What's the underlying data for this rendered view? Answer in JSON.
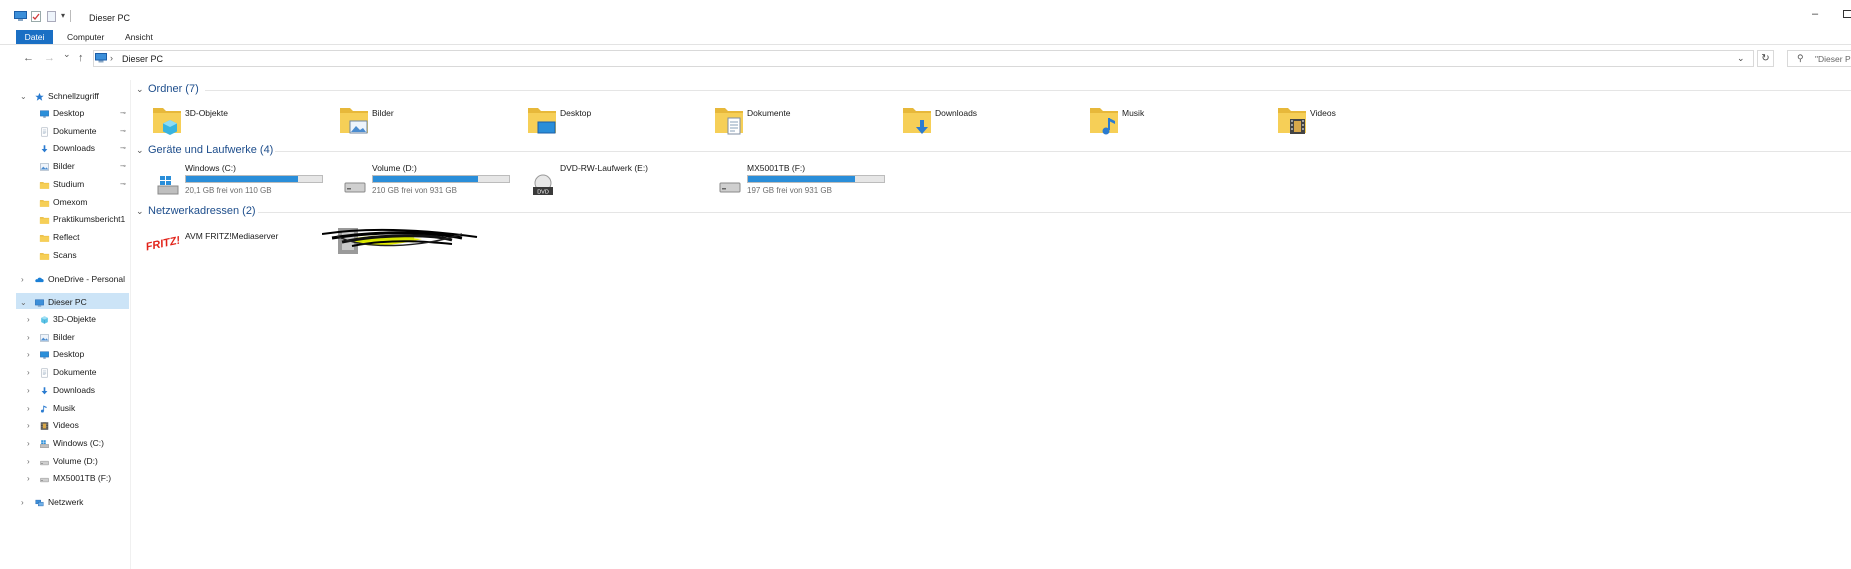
{
  "window": {
    "title": "Dieser PC",
    "minimize_glyph": "–"
  },
  "ribbon": {
    "tabs": [
      "Datei",
      "Computer",
      "Ansicht"
    ]
  },
  "address": {
    "path": "Dieser PC",
    "separator": "›",
    "search_placeholder": "\"Dieser P"
  },
  "icons": {
    "back": "←",
    "forward": "→",
    "recent": "⌄",
    "up": "↑",
    "dropdown": "⌄",
    "refresh": "↻",
    "search": "⚲",
    "chevron_down": "⌄",
    "chevron_right": "›",
    "pin": "📌"
  },
  "nav": {
    "quick_access": {
      "label": "Schnellzugriff",
      "items": [
        {
          "label": "Desktop",
          "icon": "desktop-icon",
          "pinned": true
        },
        {
          "label": "Dokumente",
          "icon": "documents-icon",
          "pinned": true
        },
        {
          "label": "Downloads",
          "icon": "downloads-icon",
          "pinned": true
        },
        {
          "label": "Bilder",
          "icon": "pictures-icon",
          "pinned": true
        },
        {
          "label": "Studium",
          "icon": "folder-icon",
          "pinned": true
        },
        {
          "label": "Omexom",
          "icon": "folder-icon",
          "pinned": false
        },
        {
          "label": "Praktikumsbericht1",
          "icon": "folder-icon",
          "pinned": false
        },
        {
          "label": "Reflect",
          "icon": "folder-icon",
          "pinned": false
        },
        {
          "label": "Scans",
          "icon": "folder-icon",
          "pinned": false
        }
      ]
    },
    "onedrive": {
      "label": "OneDrive - Personal"
    },
    "this_pc": {
      "label": "Dieser PC",
      "items": [
        {
          "label": "3D-Objekte",
          "icon": "3d-objects-icon"
        },
        {
          "label": "Bilder",
          "icon": "pictures-icon"
        },
        {
          "label": "Desktop",
          "icon": "desktop-icon"
        },
        {
          "label": "Dokumente",
          "icon": "documents-icon"
        },
        {
          "label": "Downloads",
          "icon": "downloads-icon"
        },
        {
          "label": "Musik",
          "icon": "music-icon"
        },
        {
          "label": "Videos",
          "icon": "videos-icon"
        },
        {
          "label": "Windows (C:)",
          "icon": "windows-drive-icon"
        },
        {
          "label": "Volume (D:)",
          "icon": "drive-icon"
        },
        {
          "label": "MX5001TB (F:)",
          "icon": "drive-icon"
        }
      ]
    },
    "network": {
      "label": "Netzwerk"
    }
  },
  "content": {
    "folders_header": "Ordner (7)",
    "folders": [
      {
        "label": "3D-Objekte",
        "icon": "3d-objects-icon"
      },
      {
        "label": "Bilder",
        "icon": "pictures-icon"
      },
      {
        "label": "Desktop",
        "icon": "desktop-icon"
      },
      {
        "label": "Dokumente",
        "icon": "documents-icon"
      },
      {
        "label": "Downloads",
        "icon": "downloads-icon"
      },
      {
        "label": "Musik",
        "icon": "music-icon"
      },
      {
        "label": "Videos",
        "icon": "videos-icon"
      }
    ],
    "drives_header": "Geräte und Laufwerke (4)",
    "drives": [
      {
        "label": "Windows (C:)",
        "free_text": "20,1 GB frei von 110 GB",
        "used_fraction": 0.82,
        "icon": "windows-drive-icon",
        "has_bar": true
      },
      {
        "label": "Volume (D:)",
        "free_text": "210 GB frei von 931 GB",
        "used_fraction": 0.77,
        "icon": "drive-icon",
        "has_bar": true
      },
      {
        "label": "DVD-RW-Laufwerk (E:)",
        "free_text": "",
        "used_fraction": 0,
        "icon": "dvd-drive-icon",
        "has_bar": false
      },
      {
        "label": "MX5001TB (F:)",
        "free_text": "197 GB frei von 931 GB",
        "used_fraction": 0.79,
        "icon": "drive-icon",
        "has_bar": true
      }
    ],
    "network_header": "Netzwerkadressen (2)",
    "network": [
      {
        "label": "AVM FRITZ!Mediaserver",
        "icon": "fritz-icon",
        "logo_text": "FRITZ!"
      },
      {
        "label": "",
        "icon": "redacted-device-icon"
      }
    ]
  },
  "colors": {
    "accent": "#1a6fc4",
    "selection": "#cce4f7",
    "bar_fill": "#2a8ed9",
    "group_header": "#1e4e8c",
    "folder_yellow": "#f6cf57"
  }
}
